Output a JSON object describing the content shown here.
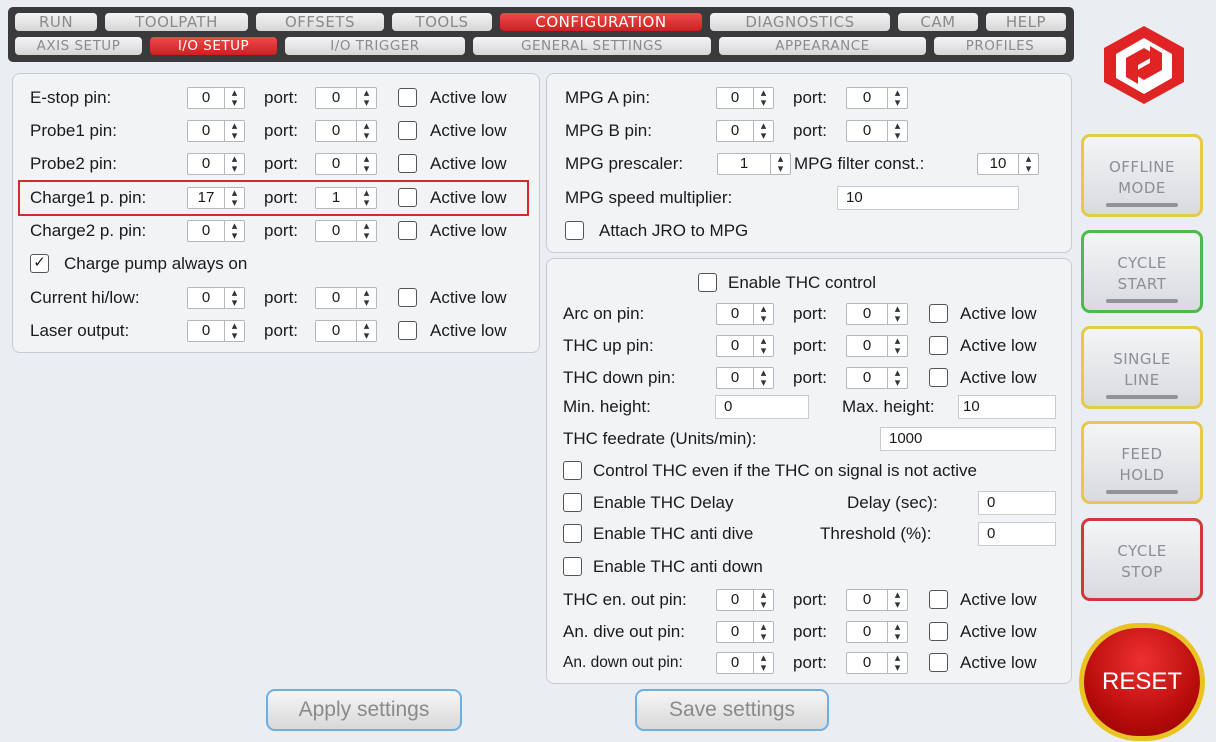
{
  "tabs_row1": [
    "RUN",
    "TOOLPATH",
    "OFFSETS",
    "TOOLS",
    "CONFIGURATION",
    "DIAGNOSTICS",
    "CAM",
    "HELP"
  ],
  "tabs_row2": [
    "AXIS SETUP",
    "I/O SETUP",
    "I/O TRIGGER",
    "GENERAL SETTINGS",
    "APPEARANCE",
    "PROFILES"
  ],
  "io": {
    "port_label": "port:",
    "active_low_label": "Active low",
    "estop": {
      "label": "E-stop pin:",
      "pin": "0",
      "port": "0"
    },
    "probe1": {
      "label": "Probe1 pin:",
      "pin": "0",
      "port": "0"
    },
    "probe2": {
      "label": "Probe2 pin:",
      "pin": "0",
      "port": "0"
    },
    "charge1": {
      "label": "Charge1 p. pin:",
      "pin": "17",
      "port": "1"
    },
    "charge2": {
      "label": "Charge2 p. pin:",
      "pin": "0",
      "port": "0"
    },
    "charge_always": {
      "label": "Charge pump always on",
      "checked": true
    },
    "current": {
      "label": "Current hi/low:",
      "pin": "0",
      "port": "0"
    },
    "laser": {
      "label": "Laser output:",
      "pin": "0",
      "port": "0"
    }
  },
  "mpg": {
    "a": {
      "label": "MPG A pin:",
      "pin": "0",
      "port": "0"
    },
    "b": {
      "label": "MPG B pin:",
      "pin": "0",
      "port": "0"
    },
    "prescaler_label": "MPG prescaler:",
    "prescaler": "1",
    "filter_label": "MPG filter const.:",
    "filter": "10",
    "speed_label": "MPG speed multiplier:",
    "speed": "10",
    "jro_label": "Attach JRO to MPG"
  },
  "thc": {
    "enable_label": "Enable THC control",
    "arc": {
      "label": "Arc on pin:",
      "pin": "0",
      "port": "0"
    },
    "up": {
      "label": "THC up pin:",
      "pin": "0",
      "port": "0"
    },
    "down": {
      "label": "THC down pin:",
      "pin": "0",
      "port": "0"
    },
    "min_label": "Min. height:",
    "min": "0",
    "max_label": "Max. height:",
    "max": "10",
    "feed_label": "THC feedrate (Units/min):",
    "feed": "1000",
    "control_label": "Control THC even if the THC on signal is not active",
    "delay_enable_label": "Enable THC Delay",
    "delay_label": "Delay (sec):",
    "delay": "0",
    "antidive_label": "Enable THC anti dive",
    "threshold_label": "Threshold (%):",
    "threshold": "0",
    "antidown_label": "Enable THC anti down",
    "en_out": {
      "label": "THC en. out pin:",
      "pin": "0",
      "port": "0"
    },
    "dive_out": {
      "label": "An. dive out pin:",
      "pin": "0",
      "port": "0"
    },
    "down_out": {
      "label": "An. down out pin:",
      "pin": "0",
      "port": "0"
    }
  },
  "buttons": {
    "apply": "Apply settings",
    "save": "Save settings"
  },
  "side": {
    "offline": "OFFLINE\nMODE",
    "cycle_start": "CYCLE\nSTART",
    "single_line": "SINGLE\nLINE",
    "feed_hold": "FEED\nHOLD",
    "cycle_stop": "CYCLE\nSTOP",
    "reset": "RESET"
  },
  "colors": {
    "accent": "#d42a2a",
    "offline_border": "#e6c84a",
    "start_border": "#4cba4c",
    "single_border": "#e6c84a",
    "feed_border": "#e6c84a",
    "stop_border": "#cc3a3a"
  }
}
